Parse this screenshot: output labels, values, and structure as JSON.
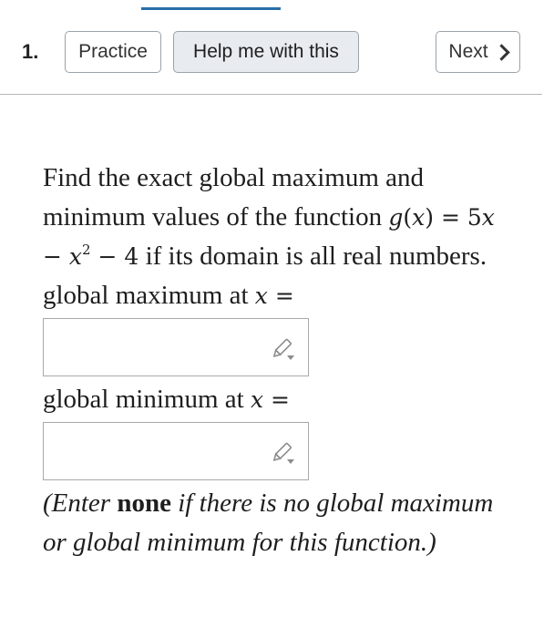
{
  "header": {
    "question_number": "1.",
    "practice_label": "Practice",
    "help_label": "Help me with this",
    "next_label": "Next"
  },
  "problem": {
    "intro": "Find the exact global maximum and minimum values of the function",
    "function_name": "g",
    "function_arg": "x",
    "function_rhs_a": "5",
    "function_exponent": "2",
    "function_rhs_c": "4",
    "domain_text": "if its domain is all real numbers.",
    "max_prompt": "global maximum at",
    "min_prompt": "global minimum at",
    "variable": "x",
    "max_value": "",
    "min_value": "",
    "note_prefix": "(Enter",
    "note_keyword": "none",
    "note_suffix": "if there is no global maximum or global minimum for this function.)"
  },
  "icons": {
    "edit": "pencil-icon",
    "next": "chevron-right-icon"
  },
  "colors": {
    "accent": "#2a6fa8",
    "help_button_bg": "#e8ebef",
    "border": "#9aa3ab"
  }
}
